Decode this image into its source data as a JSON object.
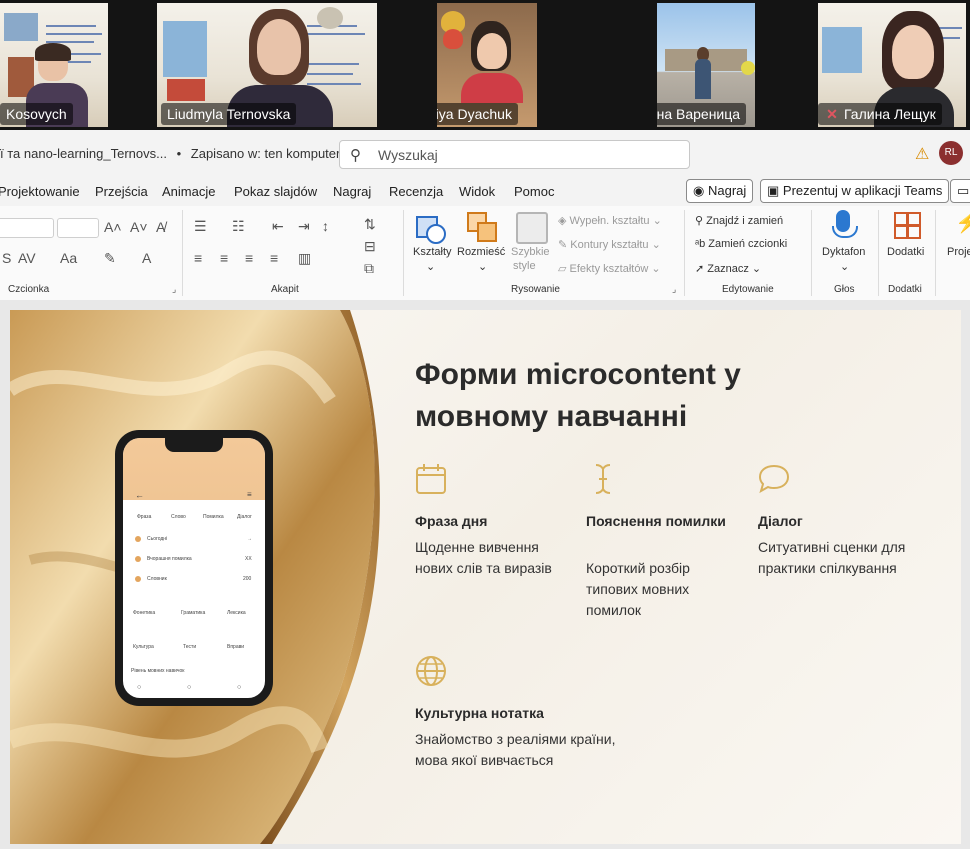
{
  "participants": [
    {
      "name": "Kosovych",
      "muted": false,
      "active": false
    },
    {
      "name": "Liudmyla Ternovska",
      "muted": false,
      "active": true
    },
    {
      "name": "Nataliya Dyachuk",
      "muted": true,
      "active": false
    },
    {
      "name": "Жанна Вареница",
      "muted": true,
      "active": false
    },
    {
      "name": "Галина  Лещук",
      "muted": true,
      "active": false
    }
  ],
  "titlebar": {
    "document": "ï та nano-learning_Ternovs...",
    "saved": "Zapisano w: ten komputer",
    "search_placeholder": "Wyszukaj",
    "avatar": "RL"
  },
  "menu": {
    "tabs": [
      "Projektowanie",
      "Przejścia",
      "Animacje",
      "Pokaz slajdów",
      "Nagraj",
      "Recenzja",
      "Widok",
      "Pomoc"
    ],
    "record_button": "Nagraj",
    "teams_button": "Prezentuj w aplikacji Teams"
  },
  "ribbon": {
    "groups": {
      "font": "Czcionka",
      "paragraph": "Akapit",
      "drawing": "Rysowanie",
      "editing": "Edytowanie",
      "voice": "Głos",
      "addins": "Dodatki"
    },
    "drawing": {
      "shapes": "Kształty",
      "arrange": "Rozmieść",
      "quick_styles_1": "Szybkie",
      "quick_styles_2": "style",
      "fill": "Wypełn. kształtu",
      "outline": "Kontury kształtu",
      "effects": "Efekty kształtów"
    },
    "editing": {
      "find": "Znajdź i zamień",
      "replace_fonts": "Zamień czcionki",
      "select": "Zaznacz"
    },
    "voice": {
      "dictate": "Dyktafon"
    },
    "addins": {
      "addins": "Dodatki",
      "next": "Proje"
    }
  },
  "slide": {
    "title": "Форми microcontent у мовному навчанні",
    "features": [
      {
        "title": "Фраза дня",
        "desc": "Щоденне вивчення нових слів та виразів",
        "icon": "calendar-icon"
      },
      {
        "title": "Пояснення помилки",
        "desc": "Короткий розбір типових мовних помилок",
        "icon": "text-cursor-icon"
      },
      {
        "title": "Діалог",
        "desc": "Ситуативні сценки для практики спілкування",
        "icon": "speech-bubble-icon"
      },
      {
        "title": "Культурна нотатка",
        "desc": "Знайомство з реаліями країни, мова якої вивчається",
        "icon": "globe-icon"
      }
    ],
    "phone": {
      "headers": [
        "Фраза",
        "Слово",
        "Помилка",
        "Діалог"
      ],
      "rows": [
        {
          "label": "Сьогодні",
          "value": "→"
        },
        {
          "label": "Вчорашня помилка",
          "value": "XX"
        },
        {
          "label": "Словник",
          "value": "200"
        }
      ],
      "grid": [
        "Фонетика",
        "Граматика",
        "Лексика",
        "Культура",
        "Тести",
        "Вправи"
      ],
      "footer": "Рівень мовних навичок"
    }
  },
  "colors": {
    "accent_gold": "#d8b15c",
    "active_speaker": "#4ade80",
    "muted_red": "#e05560"
  }
}
